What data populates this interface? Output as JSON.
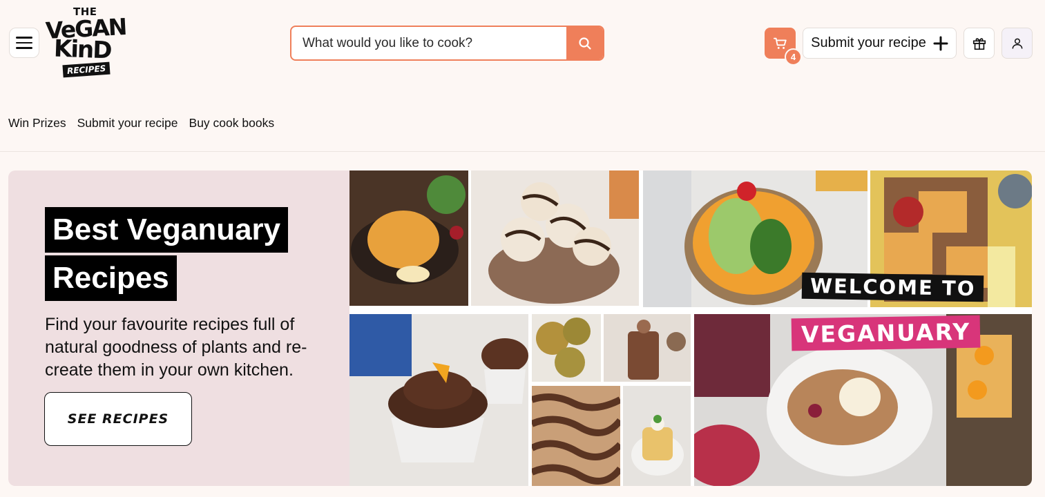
{
  "header": {
    "logo": {
      "the": "THE",
      "line1": "VeGAN",
      "line2": "KinD",
      "badge": "RECIPES"
    },
    "search": {
      "placeholder": "What would you like to cook?"
    },
    "cart": {
      "count": "4"
    },
    "submit_recipe_label": "Submit your recipe"
  },
  "nav": {
    "items": [
      "Win Prizes",
      "Submit your recipe",
      "Buy cook books"
    ]
  },
  "hero": {
    "title_line1": "Best  Veganuary",
    "title_line2": "Recipes",
    "description": "Find your favourite recipes full of natural goodness of plants and re-create them in your own kitchen.",
    "button_label": "SEE RECIPES",
    "banner_line1": "WELCOME TO",
    "banner_line2": "VEGANUARY"
  },
  "colors": {
    "accent": "#ef7f5a",
    "page_bg": "#fdf7f4",
    "hero_panel": "#efdfe1",
    "banner_pink": "#d8357a"
  },
  "icons": [
    "menu-icon",
    "search-icon",
    "cart-icon",
    "plus-icon",
    "gift-icon",
    "user-icon"
  ]
}
